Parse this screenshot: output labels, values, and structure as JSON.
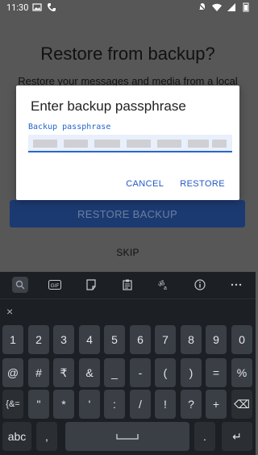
{
  "status": {
    "time": "11:30"
  },
  "background": {
    "title": "Restore from backup?",
    "subtitle": "Restore your messages and media from a local",
    "restore_button": "RESTORE BACKUP",
    "skip_button": "SKIP"
  },
  "dialog": {
    "title": "Enter backup passphrase",
    "field_label": "Backup passphrase",
    "cancel": "CANCEL",
    "restore": "RESTORE"
  },
  "keyboard": {
    "suggestion_icons": [
      "search-icon",
      "gif-icon",
      "sticker-icon",
      "clipboard-icon",
      "translate-icon",
      "info-icon",
      "more-icon"
    ],
    "clipboard_close": "×",
    "rows": [
      [
        "1",
        "2",
        "3",
        "4",
        "5",
        "6",
        "7",
        "8",
        "9",
        "0"
      ],
      [
        "@",
        "#",
        "₹",
        "&",
        "_",
        "-",
        "(",
        ")",
        "=",
        "%"
      ],
      [
        "{&=",
        "\"",
        "*",
        "'",
        ":",
        "/",
        "!",
        "?",
        "+",
        "⌫"
      ],
      [
        "abc",
        ",",
        "space",
        ".",
        "↵"
      ]
    ]
  },
  "colors": {
    "accent": "#2257c6",
    "dim_background": "#575757",
    "keyboard_bg": "#1c1f24",
    "key_bg": "#3a3e45"
  }
}
